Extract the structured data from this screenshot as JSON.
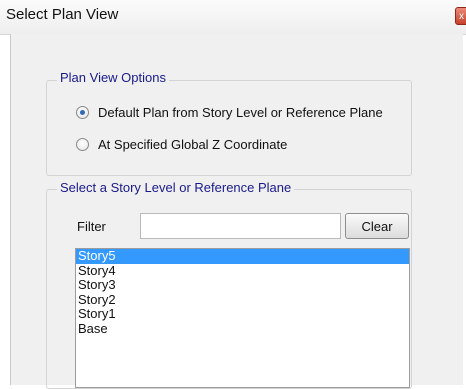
{
  "window": {
    "title": "Select Plan View",
    "close_glyph": "x"
  },
  "plan_view_options": {
    "legend": "Plan View Options",
    "options": [
      {
        "label": "Default Plan from Story Level or Reference Plane",
        "selected": true
      },
      {
        "label": "At Specified Global Z Coordinate",
        "selected": false
      }
    ]
  },
  "story_selection": {
    "legend": "Select a Story Level or Reference Plane",
    "filter_label": "Filter",
    "filter_value": "",
    "clear_label": "Clear",
    "items": [
      {
        "label": "Story5",
        "selected": true
      },
      {
        "label": "Story4",
        "selected": false
      },
      {
        "label": "Story3",
        "selected": false
      },
      {
        "label": "Story2",
        "selected": false
      },
      {
        "label": "Story1",
        "selected": false
      },
      {
        "label": "Base",
        "selected": false
      }
    ]
  },
  "colors": {
    "selection": "#3399ff",
    "legend_text": "#1a1a8a",
    "dialog_bg": "#f0f0f0"
  }
}
